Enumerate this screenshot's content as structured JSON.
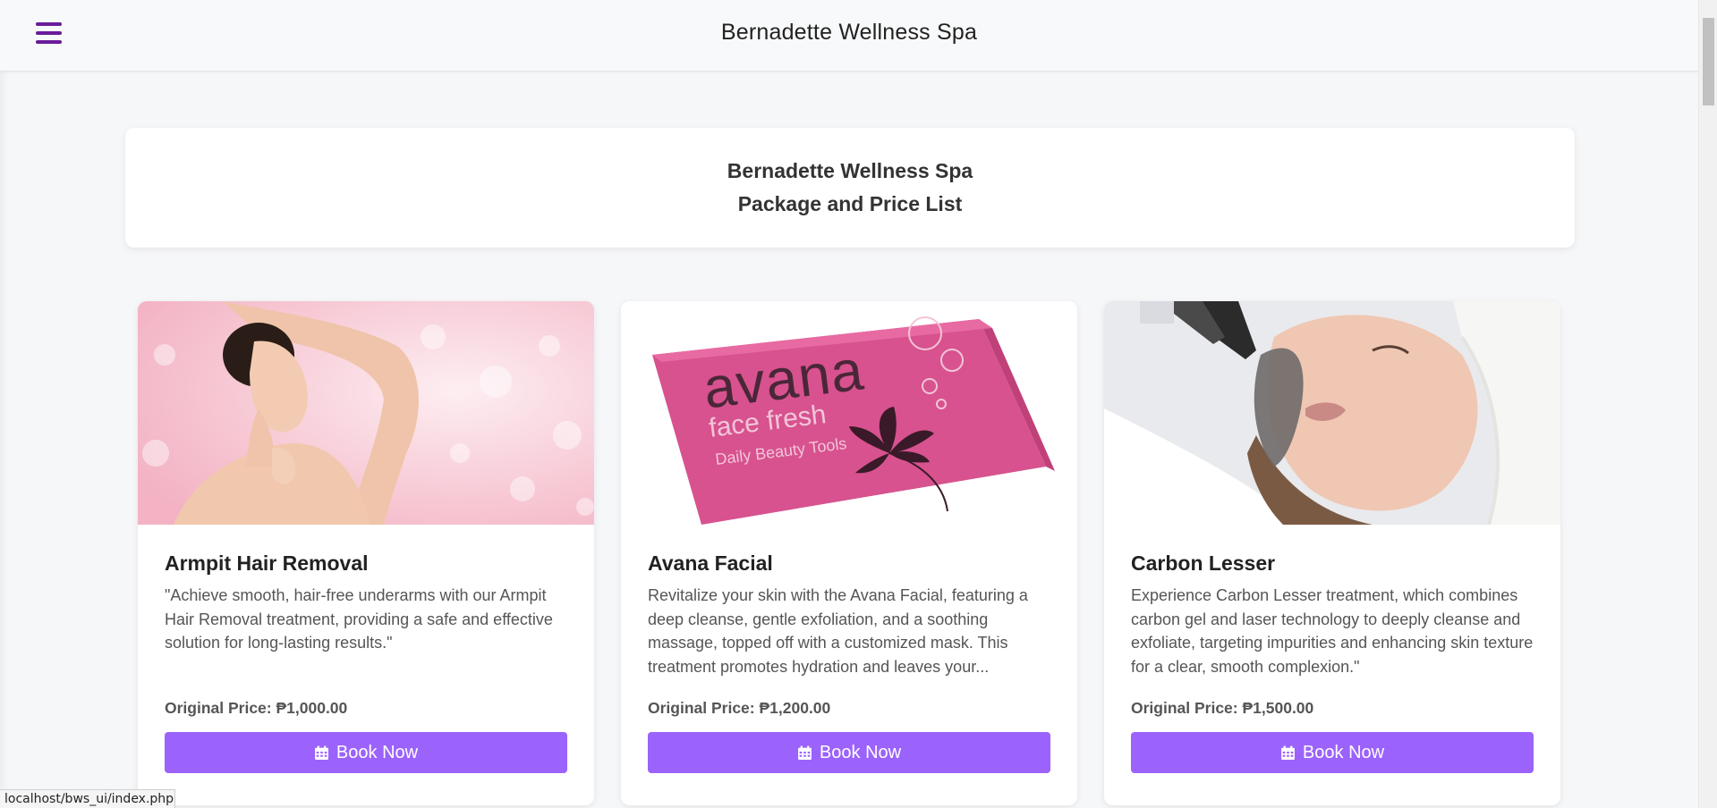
{
  "navbar": {
    "title": "Bernadette Wellness Spa",
    "menu_icon": "hamburger-icon",
    "accent_color": "#6a1b9a"
  },
  "header": {
    "line1": "Bernadette Wellness Spa",
    "line2": "Package and Price List"
  },
  "services": [
    {
      "name": "Armpit Hair Removal",
      "description": "\"Achieve smooth, hair-free underarms with our Armpit Hair Removal treatment, providing a safe and effective solution for long-lasting results.\"",
      "price": "Original Price: ₱1,000.00",
      "button": "Book Now",
      "image_subject": "woman-armpit-photo"
    },
    {
      "name": "Avana Facial",
      "description": "Revitalize your skin with the Avana Facial, featuring a deep cleanse, gentle exfoliation, and a soothing massage, topped off with a customized mask. This treatment promotes hydration and leaves your...",
      "price": "Original Price: ₱1,200.00",
      "button": "Book Now",
      "image_subject": "avana-face-fresh-box-photo",
      "image_text": {
        "brand": "avana",
        "product": "face fresh",
        "tagline": "Daily Beauty Tools"
      }
    },
    {
      "name": "Carbon Lesser",
      "description": "Experience Carbon Lesser treatment, which combines carbon gel and laser technology to deeply cleanse and exfoliate, targeting impurities and enhancing skin texture for a clear, smooth complexion.\"",
      "price": "Original Price: ₱1,500.00",
      "button": "Book Now",
      "image_subject": "carbon-laser-facial-photo"
    }
  ],
  "button_color": "#9b63fb",
  "status_url": "localhost/bws_ui/index.php"
}
